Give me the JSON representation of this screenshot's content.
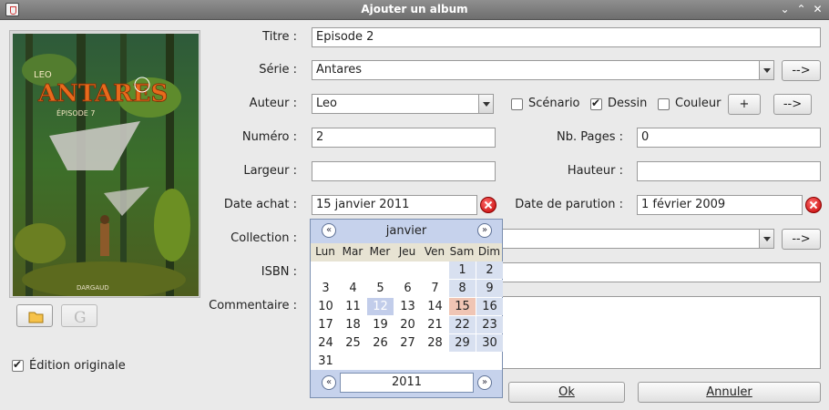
{
  "window": {
    "title": "Ajouter un album",
    "controls": [
      "chevron-down-icon",
      "chevron-up-icon",
      "close-icon"
    ]
  },
  "cover": {
    "author": "LEO",
    "title": "ANTARES",
    "episode": "ÉPISODE 7",
    "publisher": "DARGAUD"
  },
  "left": {
    "edition_originale_label": "Édition originale",
    "edition_originale_checked": true
  },
  "form": {
    "titre_label": "Titre :",
    "titre_value": "Episode 2",
    "serie_label": "Série :",
    "serie_value": "Antares",
    "auteur_label": "Auteur :",
    "auteur_value": "Leo",
    "scenario_label": "Scénario",
    "dessin_label": "Dessin",
    "couleur_label": "Couleur",
    "plus_button": "+",
    "arrow_button": "-->",
    "numero_label": "Numéro :",
    "numero_value": "2",
    "nbpages_label": "Nb. Pages :",
    "nbpages_value": "0",
    "largeur_label": "Largeur :",
    "largeur_value": "",
    "hauteur_label": "Hauteur :",
    "hauteur_value": "",
    "date_achat_label": "Date achat :",
    "date_achat_value": "15 janvier 2011",
    "date_parution_label": "Date de parution :",
    "date_parution_value": "1 février 2009",
    "collection_label": "Collection :",
    "collection_value": "",
    "isbn_label": "ISBN :",
    "isbn_value": "",
    "commentaire_label": "Commentaire :",
    "ok_button": "Ok",
    "annuler_button": "Annuler"
  },
  "calendar": {
    "month": "janvier",
    "year": "2011",
    "weekdays": [
      "Lun",
      "Mar",
      "Mer",
      "Jeu",
      "Ven",
      "Sam",
      "Dim"
    ],
    "prev": "«",
    "next": "»",
    "weeks": [
      [
        "",
        "",
        "",
        "",
        "",
        "1",
        "2"
      ],
      [
        "3",
        "4",
        "5",
        "6",
        "7",
        "8",
        "9"
      ],
      [
        "10",
        "11",
        "12",
        "13",
        "14",
        "15",
        "16"
      ],
      [
        "17",
        "18",
        "19",
        "20",
        "21",
        "22",
        "23"
      ],
      [
        "24",
        "25",
        "26",
        "27",
        "28",
        "29",
        "30"
      ],
      [
        "31",
        "",
        "",
        "",
        "",
        "",
        ""
      ]
    ],
    "highlighted_day": "12",
    "selected_day": "15"
  }
}
